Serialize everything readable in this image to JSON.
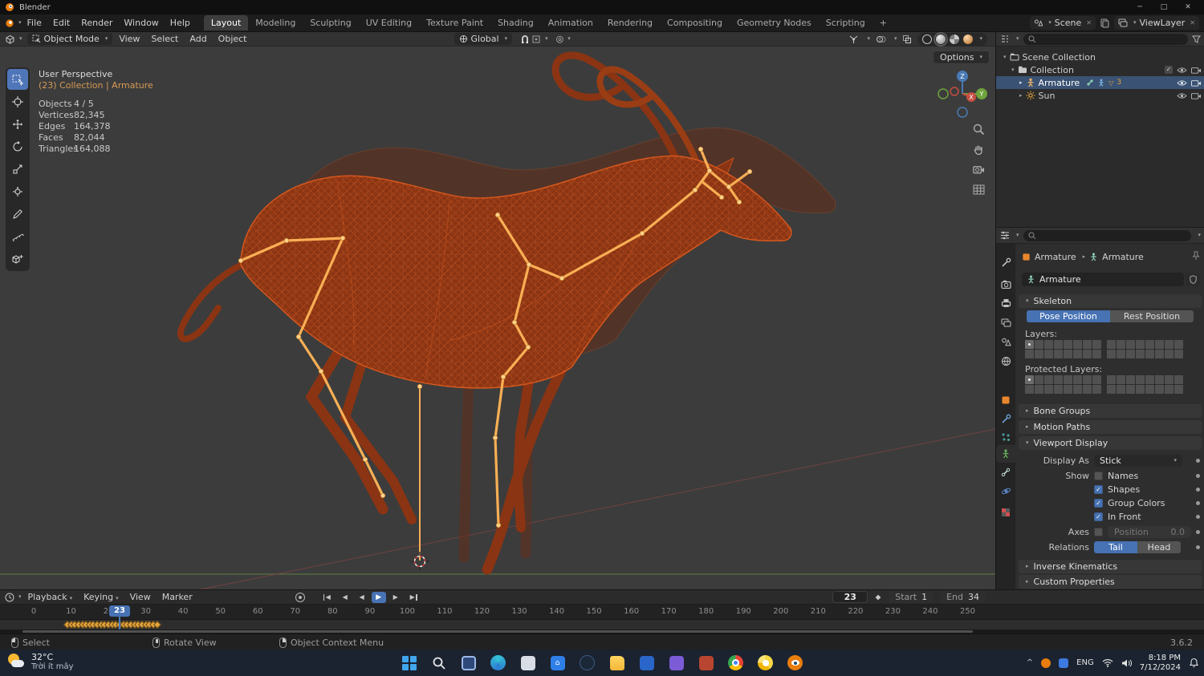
{
  "glyphs": {
    "chevron": "▾",
    "tri_right": "▸",
    "tri_down": "▾",
    "tri_down_outline": "▽",
    "check": "✓",
    "close": "✕",
    "plus": "+",
    "minimize": "─",
    "maximize": "□",
    "left": "◀",
    "right": "▶",
    "prop_edit": "◎",
    "caret_up": "^"
  },
  "titlebar": {
    "app_name": "Blender"
  },
  "menubar": {
    "menus": [
      "File",
      "Edit",
      "Render",
      "Window",
      "Help"
    ],
    "workspaces": [
      "Layout",
      "Modeling",
      "Sculpting",
      "UV Editing",
      "Texture Paint",
      "Shading",
      "Animation",
      "Rendering",
      "Compositing",
      "Geometry Nodes",
      "Scripting"
    ],
    "add_tab": "+",
    "scene_name": "Scene",
    "view_layer_name": "ViewLayer"
  },
  "viewport": {
    "header": {
      "mode": "Object Mode",
      "menus": [
        "View",
        "Select",
        "Add",
        "Object"
      ],
      "orientation": "Global",
      "options": "Options"
    },
    "overlay": {
      "perspective": "User Perspective",
      "context": "(23) Collection | Armature",
      "stats": [
        {
          "label": "Objects",
          "value": "4 / 5"
        },
        {
          "label": "Vertices",
          "value": "82,345"
        },
        {
          "label": "Edges",
          "value": "164,378"
        },
        {
          "label": "Faces",
          "value": "82,044"
        },
        {
          "label": "Triangles",
          "value": "164,088"
        }
      ]
    },
    "gizmo": {
      "x": "X",
      "y": "Y",
      "z": "Z"
    }
  },
  "outliner": {
    "items": [
      {
        "label": "Scene Collection"
      },
      {
        "label": "Collection"
      },
      {
        "label": "Armature",
        "badge": "3"
      },
      {
        "label": "Sun"
      }
    ]
  },
  "properties": {
    "breadcrumb": {
      "object": "Armature",
      "data": "Armature"
    },
    "name_value": "Armature",
    "skeleton": {
      "title": "Skeleton",
      "pose": "Pose Position",
      "rest": "Rest Position",
      "layers_label": "Layers:",
      "protected_label": "Protected Layers:",
      "layers_blocks": [
        [
          0
        ],
        []
      ],
      "protected_blocks": [
        [
          0
        ],
        []
      ]
    },
    "panels": {
      "bone_groups": "Bone Groups",
      "motion_paths": "Motion Paths",
      "viewport_display": "Viewport Display",
      "inverse_kinematics": "Inverse Kinematics",
      "custom_properties": "Custom Properties"
    },
    "display": {
      "display_as_label": "Display As",
      "display_as_value": "Stick",
      "show_label": "Show",
      "names": "Names",
      "shapes": "Shapes",
      "group_colors": "Group Colors",
      "in_front": "In Front",
      "axes_label": "Axes",
      "position_label": "Position",
      "position_value": "0.0",
      "relations_label": "Relations",
      "tail": "Tail",
      "head": "Head"
    }
  },
  "timeline": {
    "menus": [
      "Playback",
      "Keying",
      "View",
      "Marker"
    ],
    "transport": [
      "◀",
      "◀",
      "◀",
      "▶",
      "▶",
      "▶"
    ],
    "current_frame": "23",
    "current_frame_num": 23,
    "start_label": "Start",
    "start_value": "1",
    "end_label": "End",
    "end_value": "34",
    "ticks": [
      "0",
      "10",
      "20",
      "30",
      "40",
      "50",
      "60",
      "70",
      "80",
      "90",
      "100",
      "110",
      "120",
      "130",
      "140",
      "150",
      "160",
      "170",
      "180",
      "190",
      "200",
      "210",
      "220",
      "230",
      "240",
      "250"
    ],
    "keyframes": [
      9,
      10,
      11,
      12,
      13,
      14,
      15,
      16,
      17,
      18,
      19,
      20,
      21,
      22,
      23,
      24,
      25,
      26,
      27,
      28,
      29,
      30,
      31,
      32,
      33
    ]
  },
  "statusbar": {
    "items": [
      "Select",
      "Rotate View",
      "Object Context Menu"
    ],
    "version": "3.6.2"
  },
  "taskbar": {
    "weather_temp": "32°C",
    "weather_desc": "Trời ít mây",
    "lang": "ENG",
    "time": "8:18 PM",
    "date": "7/12/2024"
  }
}
